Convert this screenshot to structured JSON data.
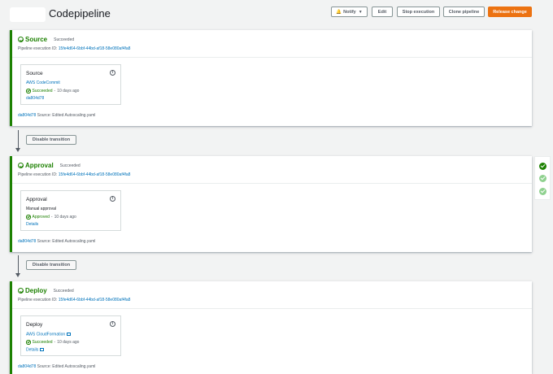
{
  "header": {
    "title": "Codepipeline",
    "buttons": {
      "notify": "Notify",
      "edit": "Edit",
      "stop": "Stop execution",
      "clone": "Clone pipeline",
      "release": "Release change"
    }
  },
  "common": {
    "exec_label": "Pipeline execution ID:",
    "exec_id": "15fe4d64-6bbf-44bd-af18-58e080af4fa8",
    "commit_id": "da804d78",
    "commit_msg": "Source: Edited Autoscaling.yaml",
    "transition_label": "Disable transition"
  },
  "stages": [
    {
      "name": "Source",
      "status": "Succeeded",
      "action": {
        "name": "Source",
        "provider": "AWS CodeCommit",
        "status": "Succeeded",
        "time": "10 days ago",
        "link": "da804d78"
      }
    },
    {
      "name": "Approval",
      "status": "Succeeded",
      "action": {
        "name": "Approval",
        "provider": "Manual approval",
        "status": "Approved",
        "time": "10 days ago",
        "link": "Details"
      }
    },
    {
      "name": "Deploy",
      "status": "Succeeded",
      "action": {
        "name": "Deploy",
        "provider": "AWS CloudFormation",
        "status": "Succeeded",
        "time": "10 days ago",
        "link": "Details"
      }
    }
  ],
  "colors": {
    "success": "#1d8102",
    "link": "#0073bb",
    "primary": "#ec7211"
  },
  "icons": {
    "notify": "bell-icon",
    "caret": "caret-down-icon",
    "status": "check-circle-icon",
    "info": "info-icon",
    "external": "external-link-icon"
  }
}
